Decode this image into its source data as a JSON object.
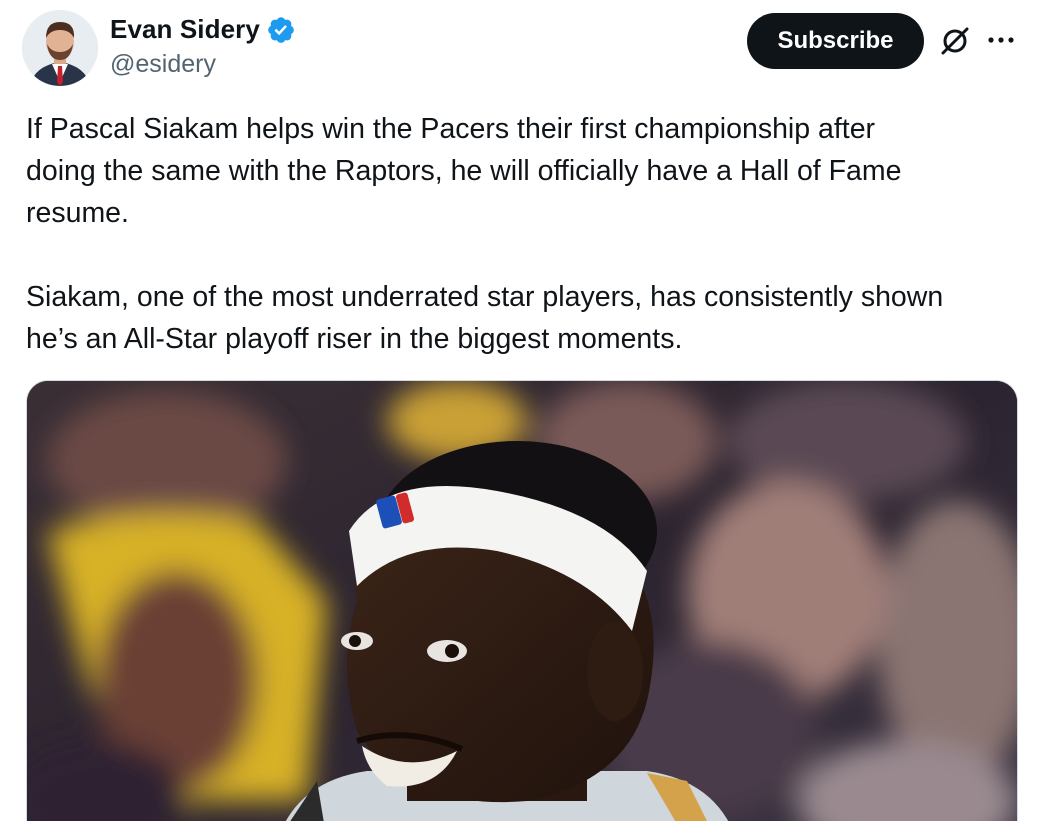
{
  "author": {
    "name": "Evan Sidery",
    "handle": "@esidery",
    "verified": true
  },
  "actions": {
    "subscribe_label": "Subscribe",
    "grok_icon": "grok-icon",
    "more_icon": "more-horizontal-icon"
  },
  "tweet": {
    "paragraph1": [
      "If Pascal Siakam helps win the Pacers their first championship after",
      "doing the same with the Raptors, he will officially have a Hall of Fame",
      "resume."
    ],
    "paragraph2": [
      "Siakam, one of the most underrated star players, has consistently shown",
      "he’s an All-Star playoff riser in the biggest moments."
    ]
  },
  "media": {
    "type": "photo"
  },
  "colors": {
    "text": "#0f1419",
    "secondary_text": "#536471",
    "verified_blue": "#1d9bf0",
    "subscribe_bg": "#0f1419",
    "subscribe_text": "#ffffff"
  }
}
